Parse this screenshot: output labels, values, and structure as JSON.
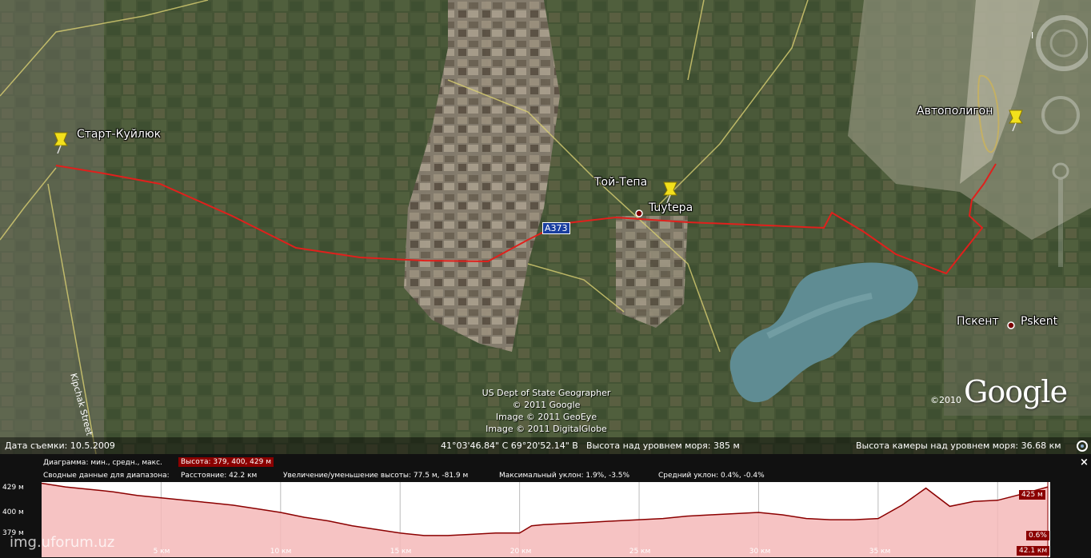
{
  "map": {
    "placemarks": [
      {
        "label": "Старт-Куйлюк"
      },
      {
        "label": "Той-Тепа"
      },
      {
        "label": "Автополигон"
      }
    ],
    "towns": [
      {
        "label": "Tuytepa"
      },
      {
        "label": "Pskent"
      }
    ],
    "town_labels_ru": {
      "pskent": "Пскент"
    },
    "road_shield": "A373",
    "street_label": "Kipchak Street",
    "credits": [
      "US Dept of State Geographer",
      "© 2011 Google",
      "Image © 2011 GeoEye",
      "Image © 2011 DigitalGlobe"
    ],
    "copyright": "©2010",
    "logo": "Google",
    "colors": {
      "route": "#e0201c",
      "reservoir": "#5f8c93"
    }
  },
  "status": {
    "imagery_date": "Дата съемки: 10.5.2009",
    "coords": "41°03'46.84\" С  69°20'52.14\" В",
    "elevation": "Высота над уровнем моря:  385 м",
    "eye_alt": "Высота камеры над уровнем моря:   36.68 км"
  },
  "profile": {
    "row1_label": "Диаграмма: мин., средн., макс.",
    "row1_value": "Высота: 379, 400, 429 м",
    "row2_label": "Сводные данные для диапазона:",
    "distance": "Расстояние: 42.2 км",
    "gain_loss": "Увеличение/уменьшение высоты: 77.5 м, -81.9 м",
    "max_slope": "Максимальный уклон: 1.9%, -3.5%",
    "avg_slope": "Средний уклон: 0.4%, -0.4%",
    "y_labels": [
      "429 м",
      "400 м",
      "379 м"
    ],
    "x_labels": [
      "5 км",
      "10 км",
      "15 км",
      "20 км",
      "25 км",
      "30 км",
      "35 км"
    ],
    "current_elevation": "425 м",
    "current_slope": "0.6%",
    "end_distance": "42.1 км",
    "close": "×"
  },
  "watermark": "img.uforum.uz",
  "chart_data": {
    "type": "area",
    "x_unit": "км",
    "y_unit": "м",
    "ylim": [
      379,
      429
    ],
    "xlim": [
      0,
      42.2
    ],
    "x": [
      0,
      1,
      2,
      3,
      4,
      5,
      6,
      7,
      8,
      9,
      10,
      11,
      12,
      13,
      14,
      15,
      16,
      17,
      18,
      19,
      20,
      20.5,
      21,
      22,
      23,
      24,
      25,
      26,
      27,
      28,
      29,
      30,
      31,
      32,
      33,
      34,
      35,
      36,
      37,
      38,
      39,
      40,
      41,
      42.1
    ],
    "y": [
      428,
      425,
      423,
      421,
      418,
      416,
      414,
      412,
      410,
      407,
      404,
      400,
      397,
      393,
      390,
      387,
      385,
      385,
      386,
      387,
      387,
      393,
      394,
      395,
      396,
      397,
      398,
      399,
      401,
      402,
      403,
      404,
      402,
      399,
      398,
      398,
      399,
      410,
      424,
      409,
      413,
      414,
      419,
      425
    ]
  }
}
